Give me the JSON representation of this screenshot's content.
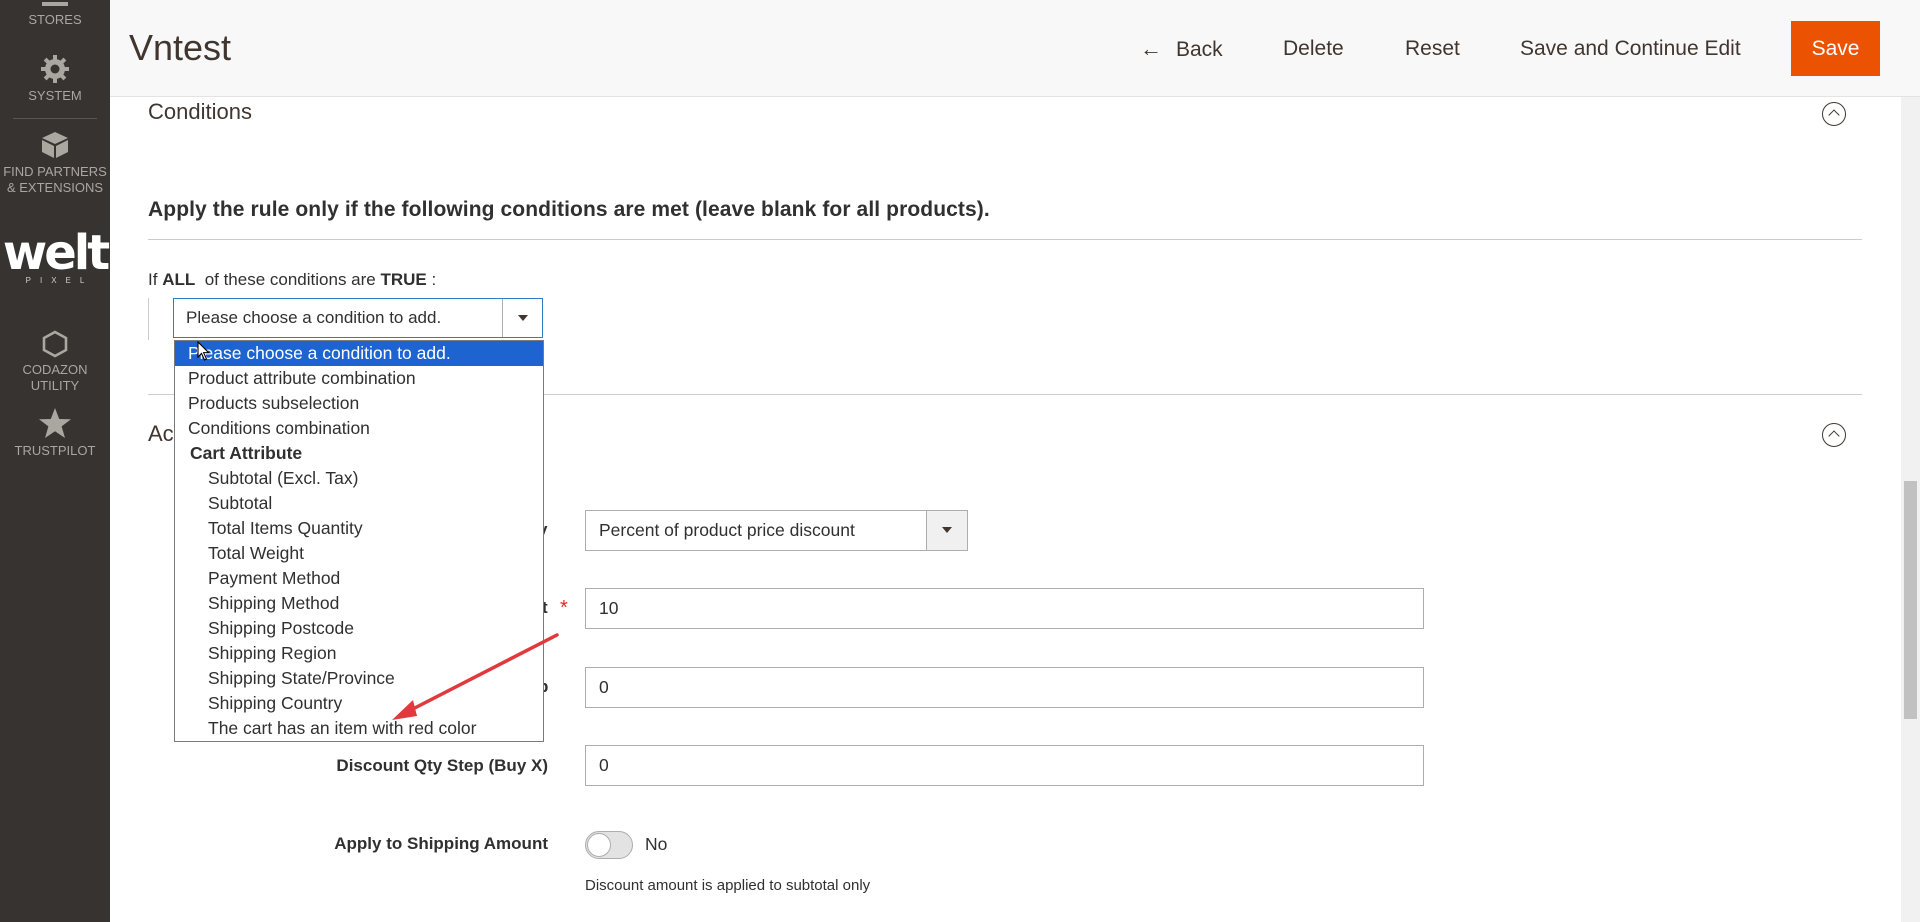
{
  "sidebar": {
    "items": [
      {
        "label": "STORES",
        "icon": "stores-icon"
      },
      {
        "label": "SYSTEM",
        "icon": "gear-icon"
      },
      {
        "label_line1": "FIND PARTNERS",
        "label_line2": "& EXTENSIONS",
        "icon": "box-icon"
      },
      {
        "label_line1": "CODAZON",
        "label_line2": "UTILITY",
        "icon": "hexagon-icon"
      },
      {
        "label": "TRUSTPILOT",
        "icon": "star-icon"
      }
    ],
    "logo": {
      "main": "welt",
      "sub": "PIXEL"
    }
  },
  "header": {
    "title": "Vntest",
    "back_label": "Back",
    "delete_label": "Delete",
    "reset_label": "Reset",
    "save_continue_label": "Save and Continue Edit",
    "save_label": "Save"
  },
  "conditions": {
    "section_title": "Conditions",
    "legend": "Apply the rule only if the following conditions are met (leave blank for all products).",
    "if_prefix": "If",
    "aggregator": "ALL",
    "middle": "of these conditions are",
    "value": "TRUE",
    "suffix": ":",
    "select_value": "Please choose a condition to add.",
    "dropdown_options": [
      {
        "label": "Please choose a condition to add.",
        "kind": "selected"
      },
      {
        "label": "Product attribute combination",
        "kind": "option"
      },
      {
        "label": "Products subselection",
        "kind": "option"
      },
      {
        "label": "Conditions combination",
        "kind": "option"
      },
      {
        "label": "Cart Attribute",
        "kind": "group"
      },
      {
        "label": "Subtotal (Excl. Tax)",
        "kind": "sub"
      },
      {
        "label": "Subtotal",
        "kind": "sub"
      },
      {
        "label": "Total Items Quantity",
        "kind": "sub"
      },
      {
        "label": "Total Weight",
        "kind": "sub"
      },
      {
        "label": "Payment Method",
        "kind": "sub"
      },
      {
        "label": "Shipping Method",
        "kind": "sub"
      },
      {
        "label": "Shipping Postcode",
        "kind": "sub"
      },
      {
        "label": "Shipping Region",
        "kind": "sub"
      },
      {
        "label": "Shipping State/Province",
        "kind": "sub"
      },
      {
        "label": "Shipping Country",
        "kind": "sub"
      },
      {
        "label": "The cart has an item with red color",
        "kind": "sub"
      }
    ]
  },
  "actions": {
    "section_title_visible": "Ac",
    "apply_label_tail": "y",
    "apply_value": "Percent of product price discount",
    "amount_label_tail": "t",
    "amount_value": "10",
    "max_qty_label_tail": "p",
    "max_qty_value": "0",
    "step_label": "Discount Qty Step (Buy X)",
    "step_value": "0",
    "shipping_label": "Apply to Shipping Amount",
    "shipping_toggle_value": "No",
    "shipping_note": "Discount amount is applied to subtotal only"
  },
  "colors": {
    "sidebar_bg": "#373330",
    "save_button": "#eb5202",
    "selected_option": "#1e64d0",
    "annotation_arrow": "#e0393e"
  }
}
